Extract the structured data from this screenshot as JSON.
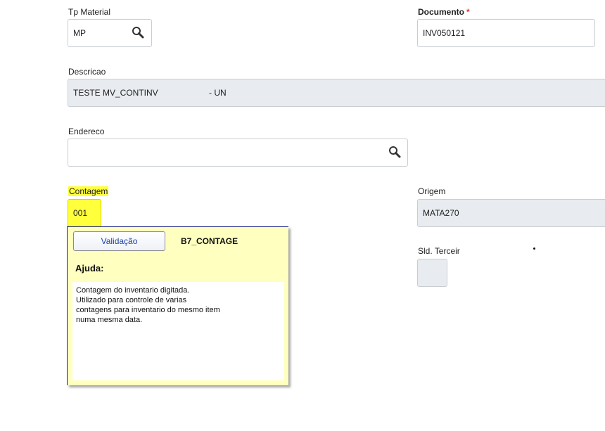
{
  "fields": {
    "tp_material": {
      "label": "Tp Material",
      "value": "MP",
      "icon": "search-icon"
    },
    "documento": {
      "label": "Documento",
      "required_mark": "*",
      "value": "INV050121"
    },
    "descricao": {
      "label": "Descricao",
      "value": "TESTE MV_CONTINV",
      "unit": "- UN"
    },
    "endereco": {
      "label": "Endereco",
      "value": "",
      "icon": "search-icon"
    },
    "contagem": {
      "label": "Contagem",
      "value": "001",
      "highlight_color": "#ffff3b"
    },
    "origem": {
      "label": "Origem",
      "value": "MATA270"
    },
    "sld_terceir": {
      "label": "Sld. Terceir",
      "value": ""
    }
  },
  "help_popup": {
    "validation_button": "Validação",
    "field_code": "B7_CONTAGE",
    "help_title": "Ajuda:",
    "help_lines": [
      "Contagem do inventario digitada.",
      "Utilizado para controle de varias",
      "contagens para inventario do mesmo item",
      "numa mesma data."
    ]
  },
  "colors": {
    "required": "#e53935",
    "popup_background": "#ffffc0",
    "readonly_background": "#e8ebef",
    "link_text": "#1a3fa8"
  }
}
